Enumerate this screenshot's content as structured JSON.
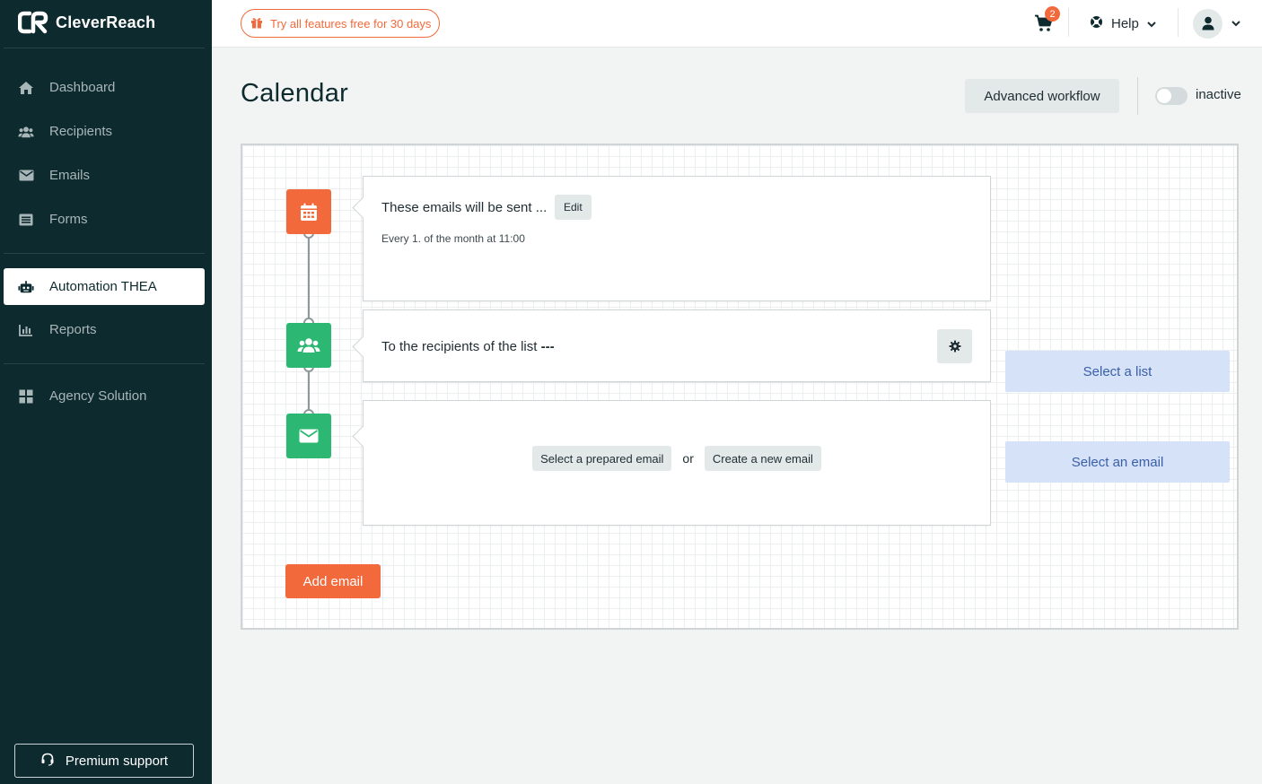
{
  "brand": {
    "name": "CleverReach",
    "accent": "#f26a3b",
    "sidebar_bg": "#0d2a2f",
    "success": "#2cb873",
    "secondary_blue": "#d6e2f8"
  },
  "sidebar": {
    "items": [
      {
        "label": "Dashboard",
        "icon": "home-icon"
      },
      {
        "label": "Recipients",
        "icon": "users-icon"
      },
      {
        "label": "Emails",
        "icon": "envelope-icon"
      },
      {
        "label": "Forms",
        "icon": "form-icon"
      },
      {
        "label": "Automation THEA",
        "icon": "robot-icon",
        "active": true
      },
      {
        "label": "Reports",
        "icon": "chart-icon"
      },
      {
        "label": "Agency Solution",
        "icon": "grid-icon"
      }
    ],
    "premium_support": "Premium support"
  },
  "topbar": {
    "trial_label": "Try all features free for 30 days",
    "cart_count": "2",
    "help_label": "Help"
  },
  "header": {
    "title": "Calendar",
    "advanced_workflow": "Advanced workflow",
    "status_label": "inactive",
    "status_active": false
  },
  "workflow": {
    "trigger": {
      "title": "These emails will be sent ...",
      "edit_label": "Edit",
      "schedule": "Every 1. of the month at 11:00"
    },
    "recipients": {
      "text": "To the recipients of the list",
      "list_value": "---"
    },
    "email": {
      "prepared_label": "Select a prepared email",
      "or_label": "or",
      "new_label": "Create a new email"
    },
    "select_list_label": "Select a list",
    "select_email_label": "Select an email",
    "add_email_label": "Add email"
  }
}
